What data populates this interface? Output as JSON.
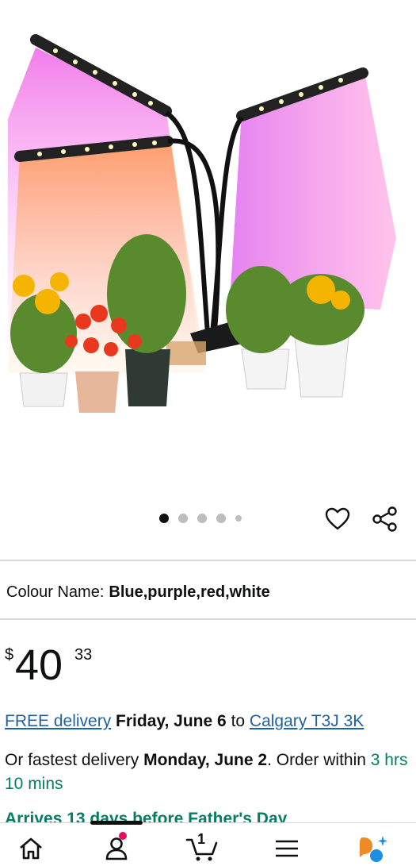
{
  "product": {
    "image_alt": "Plant grow light with three LED arms over potted flowers",
    "carousel_total": 5,
    "carousel_active": 1
  },
  "colour": {
    "label": "Colour Name:",
    "value": "Blue,purple,red,white"
  },
  "price": {
    "currency": "$",
    "whole": "40",
    "fraction": "33"
  },
  "delivery": {
    "free_link": "FREE delivery",
    "date": "Friday, June 6",
    "to": "to",
    "location_link": "Calgary T3J 3K"
  },
  "fastest": {
    "prefix": "Or fastest delivery",
    "date": "Monday, June 2",
    "order_within": ". Order within",
    "countdown": "3 hrs 10 mins"
  },
  "arrives": {
    "text": "Arrives 13 days before Father's Day"
  },
  "nav": {
    "cart_count": "1",
    "icons": [
      "home-icon",
      "account-icon",
      "cart-icon",
      "menu-icon",
      "rufus-ai-icon"
    ]
  },
  "colors": {
    "link": "#2162a1",
    "teal": "#067d62",
    "badge": "#e0115f",
    "text": "#0f1111"
  }
}
